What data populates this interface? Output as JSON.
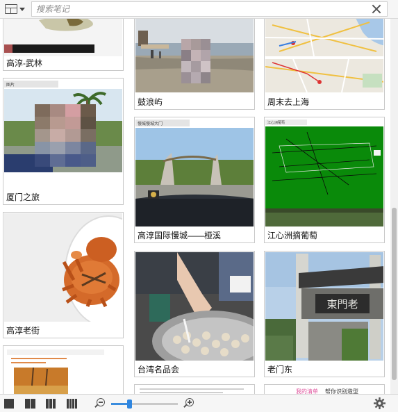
{
  "search": {
    "placeholder": "搜索笔记",
    "value": ""
  },
  "view_menu": {
    "icon": "grid-view-icon",
    "caret": "chevron-down-icon"
  },
  "notes": [
    {
      "title": "高淳-武林"
    },
    {
      "title": "鼓浪屿"
    },
    {
      "title": "周末去上海"
    },
    {
      "title": "厦门之旅"
    },
    {
      "title": "高淳国际慢城——桠溪"
    },
    {
      "title": "江心洲摘葡萄"
    },
    {
      "title": "高淳老街"
    },
    {
      "title": "台湾名品会"
    },
    {
      "title": "老门东"
    },
    {
      "title": ""
    },
    {
      "title": ""
    },
    {
      "title": ""
    }
  ],
  "thumb_labels": {
    "xiamen_header": "图片",
    "gaochun_header": "慢城慢城大门",
    "jiangxin_header": "江心洲葡萄",
    "laomendong_gate": "東門老",
    "bottom_right_text_1": "我的清单",
    "bottom_right_text_2": "帮你识别造型"
  },
  "toolbar": {
    "layouts": [
      "single-column-icon",
      "two-column-icon",
      "three-column-icon",
      "four-column-icon"
    ],
    "zoom_out_icon": "zoom-out-icon",
    "zoom_in_icon": "zoom-in-icon",
    "settings_icon": "gear-icon"
  },
  "zoom": {
    "level": 0.27
  },
  "scroll": {
    "position": 0.55
  }
}
